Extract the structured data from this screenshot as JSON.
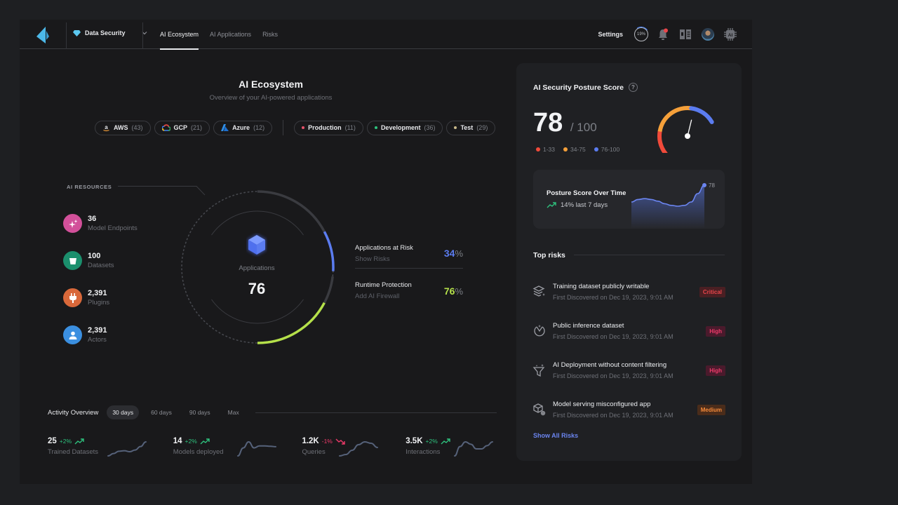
{
  "nav": {
    "product_label": "Data Security",
    "tabs": [
      {
        "label": "AI Ecosystem",
        "active": true
      },
      {
        "label": "AI Applications",
        "active": false
      },
      {
        "label": "Risks",
        "active": false
      }
    ],
    "settings_label": "Settings",
    "progress_label": "19%",
    "progress_value": 0.19
  },
  "header": {
    "title": "AI Ecosystem",
    "subtitle": "Overview of your AI-powered applications"
  },
  "filters": {
    "clouds": [
      {
        "label": "AWS",
        "count": "(43)",
        "icon": "aws-icon"
      },
      {
        "label": "GCP",
        "count": "(21)",
        "icon": "gcp-icon"
      },
      {
        "label": "Azure",
        "count": "(12)",
        "icon": "azure-icon"
      }
    ],
    "environments": [
      {
        "label": "Production",
        "count": "(11)",
        "color": "#e8526a"
      },
      {
        "label": "Development",
        "count": "(36)",
        "color": "#2ec27e"
      },
      {
        "label": "Test",
        "count": "(29)",
        "color": "#c9b98a"
      }
    ]
  },
  "resources": {
    "label": "AI RESOURCES",
    "items": [
      {
        "value": "36",
        "name": "Model Endpoints",
        "icon": "sparkles-icon",
        "color": "#d2509a"
      },
      {
        "value": "100",
        "name": "Datasets",
        "icon": "bucket-icon",
        "color": "#1b8f6d"
      },
      {
        "value": "2,391",
        "name": "Plugins",
        "icon": "plug-icon",
        "color": "#d9683a"
      },
      {
        "value": "2,391",
        "name": "Actors",
        "icon": "user-icon",
        "color": "#3b8fe0"
      }
    ]
  },
  "applications": {
    "label": "Applications",
    "value": "76",
    "at_risk_fraction": 0.34,
    "protected_fraction": 0.76
  },
  "stats": [
    {
      "title": "Applications at Risk",
      "link": "Show Risks",
      "value": "34",
      "unit": "%",
      "color": "#5b7cf0"
    },
    {
      "title": "Runtime Protection",
      "link": "Add AI Firewall",
      "value": "76",
      "unit": "%",
      "color": "#b5e04a"
    }
  ],
  "activity": {
    "title": "Activity Overview",
    "periods": [
      {
        "label": "30 days",
        "active": true
      },
      {
        "label": "60 days",
        "active": false
      },
      {
        "label": "90 days",
        "active": false
      },
      {
        "label": "Max",
        "active": false
      }
    ],
    "metrics": [
      {
        "value": "25",
        "change": "+2%",
        "direction": "up",
        "name": "Trained Datasets",
        "trend": [
          2,
          3,
          4,
          4.2,
          3.8,
          4.5,
          6,
          8
        ]
      },
      {
        "value": "14",
        "change": "+2%",
        "direction": "up",
        "name": "Models deployed",
        "trend": [
          1,
          5,
          8,
          5,
          6,
          6,
          5.8,
          5.6
        ]
      },
      {
        "value": "1.2K",
        "change": "-1%",
        "direction": "down",
        "name": "Queries",
        "trend": [
          1,
          1.5,
          3,
          5,
          6,
          5.5,
          4
        ]
      },
      {
        "value": "3.5K",
        "change": "+2%",
        "direction": "up",
        "name": "Interactions",
        "trend": [
          1,
          3,
          4,
          3.5,
          2.5,
          2.5,
          3.2,
          4
        ]
      }
    ]
  },
  "posture": {
    "title": "AI Security Posture Score",
    "score": "78",
    "max": "/ 100",
    "score_value": 78,
    "legend": [
      {
        "label": "1-33",
        "color": "#f04a3a"
      },
      {
        "label": "34-75",
        "color": "#f5a03a"
      },
      {
        "label": "76-100",
        "color": "#5b7cf0"
      }
    ],
    "trend_title": "Posture Score Over Time",
    "trend_sub": "14% last 7 days",
    "trend_end_label": "78",
    "trend": [
      60,
      63,
      64,
      63,
      61,
      58,
      56,
      55,
      56,
      60,
      70,
      80
    ]
  },
  "top_risks": {
    "title": "Top risks",
    "items": [
      {
        "title": "Training dataset publicly writable",
        "sub": "First Discovered on Dec 19, 2023, 9:01 AM",
        "severity": "Critical",
        "icon": "layers-sparkle-icon",
        "fg": "#e8454a",
        "bg": "#4a1f23"
      },
      {
        "title": "Public inference dataset",
        "sub": "First Discovered on Dec 19, 2023, 9:01 AM",
        "severity": "High",
        "icon": "inference-icon",
        "fg": "#f03a6a",
        "bg": "#4a1a2c"
      },
      {
        "title": "AI Deployment without content filtering",
        "sub": "First Discovered on Dec 19, 2023, 9:01 AM",
        "severity": "High",
        "icon": "funnel-sparkle-icon",
        "fg": "#f03a6a",
        "bg": "#4a1a2c"
      },
      {
        "title": "Model serving misconfigured app",
        "sub": "First Discovered on Dec 19, 2023, 9:01 AM",
        "severity": "Medium",
        "icon": "box-gear-icon",
        "fg": "#f58a3a",
        "bg": "#4a2c1a"
      }
    ],
    "show_all": "Show All Risks"
  }
}
